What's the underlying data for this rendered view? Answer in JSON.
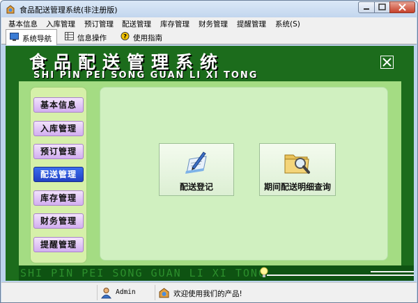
{
  "window": {
    "title": "食品配送管理系统(非注册版)"
  },
  "menu": [
    "基本信息",
    "入库管理",
    "预订管理",
    "配送管理",
    "库存管理",
    "财务管理",
    "提醒管理",
    "系统(S)"
  ],
  "tabs": [
    {
      "label": "系统导航",
      "icon": "monitor-icon",
      "active": true
    },
    {
      "label": "信息操作",
      "icon": "grid-icon",
      "active": false
    },
    {
      "label": "使用指南",
      "icon": "help-icon",
      "active": false
    }
  ],
  "header": {
    "title": "食品配送管理系统",
    "subtitle": "SHI PIN PEI SONG GUAN LI XI TONG"
  },
  "nav": [
    {
      "label": "基本信息",
      "active": false
    },
    {
      "label": "入库管理",
      "active": false
    },
    {
      "label": "预订管理",
      "active": false
    },
    {
      "label": "配送管理",
      "active": true
    },
    {
      "label": "库存管理",
      "active": false
    },
    {
      "label": "财务管理",
      "active": false
    },
    {
      "label": "提醒管理",
      "active": false
    }
  ],
  "actions": [
    {
      "label": "配送登记",
      "icon": "register-document-icon"
    },
    {
      "label": "期间配送明细查询",
      "icon": "folder-search-icon"
    }
  ],
  "ticker": {
    "text": "SHI PIN PEI SONG GUAN LI XI TONG"
  },
  "status": {
    "user": "Admin",
    "message": "欢迎使用我们的产品!"
  },
  "colors": {
    "header_green": "#1c6c1c",
    "panel_green": "#a4dc83",
    "active_nav": "#2f55d6"
  }
}
